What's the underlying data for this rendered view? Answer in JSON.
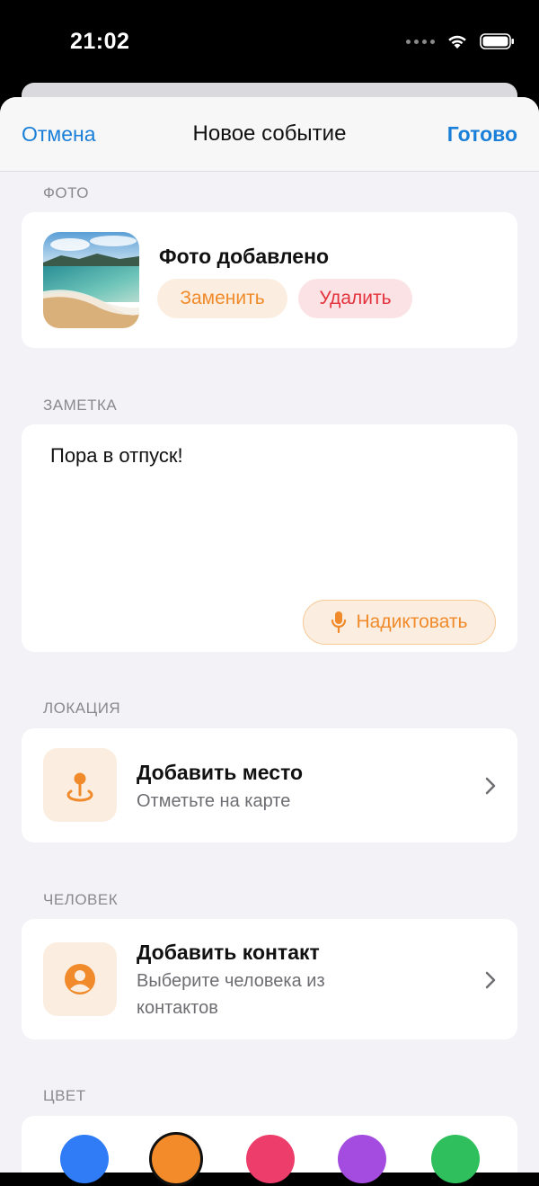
{
  "status": {
    "time": "21:02"
  },
  "nav": {
    "cancel": "Отмена",
    "title": "Новое событие",
    "done": "Готово"
  },
  "photo": {
    "section": "ФОТО",
    "title": "Фото добавлено",
    "replace": "Заменить",
    "delete": "Удалить"
  },
  "note": {
    "section": "ЗАМЕТКА",
    "text": "Пора в отпуск!",
    "dictate": "Надиктовать"
  },
  "location": {
    "section": "ЛОКАЦИЯ",
    "title": "Добавить место",
    "subtitle": "Отметьте на карте"
  },
  "person": {
    "section": "ЧЕЛОВЕК",
    "title": "Добавить контакт",
    "subtitle": "Выберите человека из контактов"
  },
  "color": {
    "section": "ЦВЕТ",
    "swatches": [
      "#2f7cf6",
      "#f38b2a",
      "#ec3d6b",
      "#a54ce0",
      "#2fbf5c"
    ],
    "selected": "#f38b2a"
  },
  "accent": "#f08a2a",
  "link_color": "#1a7fd8"
}
